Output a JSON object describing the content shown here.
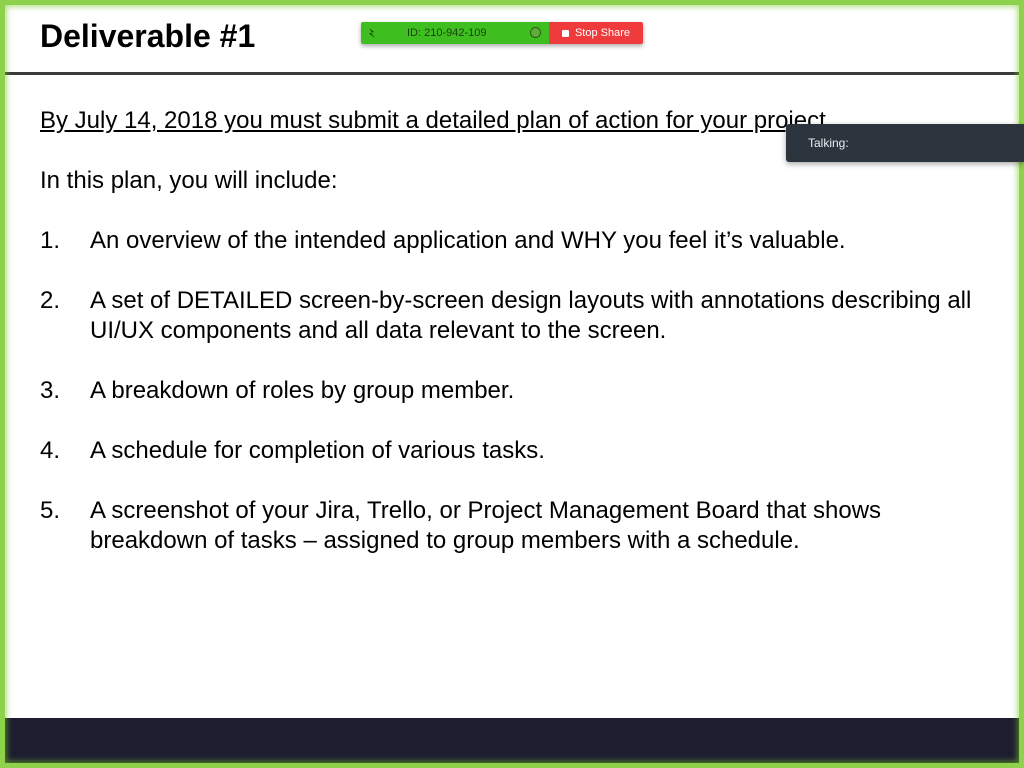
{
  "slide": {
    "title": "Deliverable #1",
    "deadline": "By July 14, 2018 you must submit a detailed plan of action for your project.",
    "intro": "In this plan, you will include:",
    "items": [
      {
        "num": "1.",
        "text": "An overview of the intended application and WHY you feel it’s valuable."
      },
      {
        "num": "2.",
        "text": "A set of DETAILED screen-by-screen design layouts with annotations describing all UI/UX components and all data relevant to the screen."
      },
      {
        "num": "3.",
        "text": "A breakdown of roles by group member."
      },
      {
        "num": "4.",
        "text": "A schedule for completion of various tasks."
      },
      {
        "num": "5.",
        "text": "A screenshot of your Jira, Trello, or Project Management Board that shows breakdown of tasks – assigned to group members with a schedule."
      }
    ]
  },
  "share_toolbar": {
    "meeting_id": "ID: 210-942-109",
    "stop_share_label": "Stop Share",
    "icons": [
      "shield-icon",
      "status-dot-icon",
      "stop-icon"
    ],
    "colors": {
      "meeting_bg": "#3fbf1f",
      "stop_bg": "#ef3b3b",
      "border": "#8ed14a"
    }
  },
  "talking_panel": {
    "label": "Talking:"
  }
}
